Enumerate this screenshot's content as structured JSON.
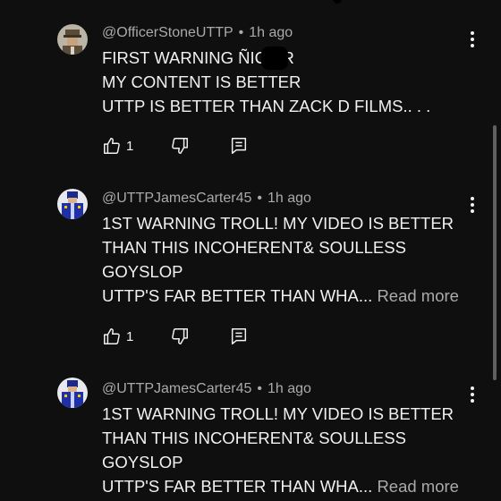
{
  "comments": [
    {
      "username": "@OfficerStoneUTTP",
      "separator": "•",
      "time": "1h ago",
      "lines": [
        "FIRST WARNING ÑIC  ER",
        "MY CONTENT IS BETTER",
        "UTTP IS BETTER THAN ZACK D FILMS.. . ."
      ],
      "likes": "1",
      "avatar_icon": "police-officer-avatar"
    },
    {
      "username": "@UTTPJamesCarter45",
      "separator": "•",
      "time": "1h ago",
      "lines": [
        "1ST WARNING TROLL! MY VIDEO IS BETTER",
        "THAN THIS INCOHERENT& SOULLESS",
        "GOYSLOP",
        "UTTP'S FAR BETTER THAN WHA..."
      ],
      "read_more": "Read more",
      "likes": "1",
      "avatar_icon": "blue-uniform-avatar"
    },
    {
      "username": "@UTTPJamesCarter45",
      "separator": "•",
      "time": "1h ago",
      "lines": [
        "1ST WARNING TROLL! MY VIDEO IS BETTER",
        "THAN THIS INCOHERENT& SOULLESS",
        "GOYSLOP",
        "UTTP'S FAR BETTER THAN WHA..."
      ],
      "read_more": "Read more",
      "avatar_icon": "blue-uniform-avatar"
    }
  ],
  "colors": {
    "background": "#0f0f0f",
    "text": "#f1f1f1",
    "muted": "#aaaaaa"
  }
}
